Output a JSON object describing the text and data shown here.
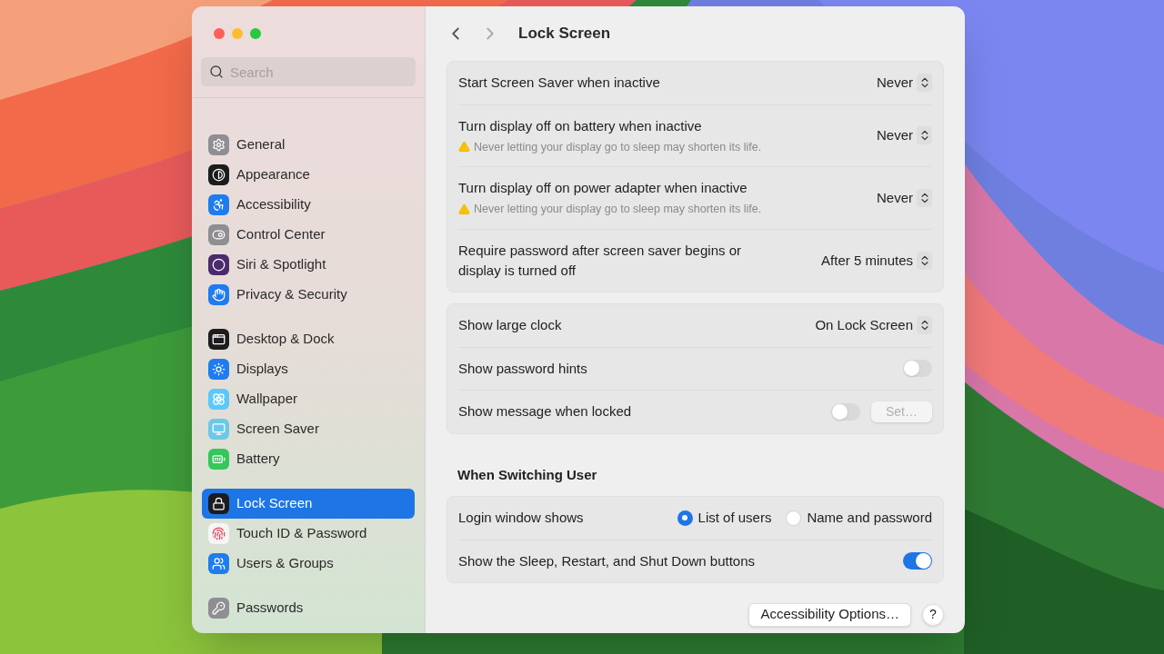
{
  "toolbar": {
    "title": "Lock Screen"
  },
  "sidebar": {
    "search": {
      "placeholder": "Search"
    },
    "groups": [
      {
        "items": [
          {
            "label": "General",
            "color": "#8e8e93",
            "selected": false
          },
          {
            "label": "Appearance",
            "color": "#1c1c1e",
            "selected": false
          },
          {
            "label": "Accessibility",
            "color": "#1f7cf0",
            "selected": false
          },
          {
            "label": "Control Center",
            "color": "#8e8e93",
            "selected": false
          },
          {
            "label": "Siri & Spotlight",
            "color": "#4a2c6e",
            "selected": false
          },
          {
            "label": "Privacy & Security",
            "color": "#1f7cf0",
            "selected": false
          }
        ]
      },
      {
        "items": [
          {
            "label": "Desktop & Dock",
            "color": "#1c1c1e",
            "selected": false
          },
          {
            "label": "Displays",
            "color": "#1f7cf0",
            "selected": false
          },
          {
            "label": "Wallpaper",
            "color": "#5ac8fa",
            "selected": false
          },
          {
            "label": "Screen Saver",
            "color": "#6cc8e8",
            "selected": false
          },
          {
            "label": "Battery",
            "color": "#34c759",
            "selected": false
          }
        ]
      },
      {
        "items": [
          {
            "label": "Lock Screen",
            "color": "#1c1c1e",
            "selected": true
          },
          {
            "label": "Touch ID & Password",
            "color": "#f5f5f5",
            "selected": false
          },
          {
            "label": "Users & Groups",
            "color": "#1f7cf0",
            "selected": false
          }
        ]
      },
      {
        "items": [
          {
            "label": "Passwords",
            "color": "#8e8e93",
            "selected": false
          }
        ]
      }
    ]
  },
  "sections": [
    {
      "rows": [
        {
          "kind": "popup",
          "label": "Start Screen Saver when inactive",
          "value": "Never"
        },
        {
          "kind": "popup",
          "label": "Turn display off on battery when inactive",
          "note": "Never letting your display go to sleep may shorten its life.",
          "value": "Never"
        },
        {
          "kind": "popup",
          "label": "Turn display off on power adapter when inactive",
          "note": "Never letting your display go to sleep may shorten its life.",
          "value": "Never"
        },
        {
          "kind": "popup",
          "label": "Require password after screen saver begins or display is turned off",
          "value": "After 5 minutes"
        }
      ]
    },
    {
      "rows": [
        {
          "kind": "popup",
          "label": "Show large clock",
          "value": "On Lock Screen"
        },
        {
          "kind": "toggle",
          "label": "Show password hints",
          "on": false
        },
        {
          "kind": "toggle",
          "label": "Show message when locked",
          "on": false,
          "button": {
            "label": "Set…",
            "disabled": true
          }
        }
      ]
    },
    {
      "heading": "When Switching User",
      "rows": [
        {
          "kind": "radio",
          "label": "Login window shows",
          "options": [
            {
              "label": "List of users",
              "selected": true
            },
            {
              "label": "Name and password",
              "selected": false
            }
          ]
        },
        {
          "kind": "toggle",
          "label": "Show the Sleep, Restart, and Shut Down buttons",
          "on": true
        }
      ]
    }
  ],
  "footer": {
    "button": "Accessibility Options…",
    "help": "?"
  }
}
